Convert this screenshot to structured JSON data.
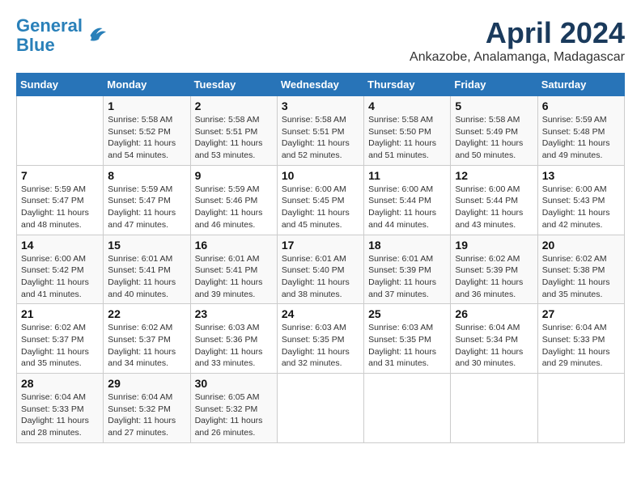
{
  "header": {
    "logo_line1": "General",
    "logo_line2": "Blue",
    "month": "April 2024",
    "location": "Ankazobe, Analamanga, Madagascar"
  },
  "columns": [
    "Sunday",
    "Monday",
    "Tuesday",
    "Wednesday",
    "Thursday",
    "Friday",
    "Saturday"
  ],
  "weeks": [
    [
      {
        "num": "",
        "info": ""
      },
      {
        "num": "1",
        "info": "Sunrise: 5:58 AM\nSunset: 5:52 PM\nDaylight: 11 hours\nand 54 minutes."
      },
      {
        "num": "2",
        "info": "Sunrise: 5:58 AM\nSunset: 5:51 PM\nDaylight: 11 hours\nand 53 minutes."
      },
      {
        "num": "3",
        "info": "Sunrise: 5:58 AM\nSunset: 5:51 PM\nDaylight: 11 hours\nand 52 minutes."
      },
      {
        "num": "4",
        "info": "Sunrise: 5:58 AM\nSunset: 5:50 PM\nDaylight: 11 hours\nand 51 minutes."
      },
      {
        "num": "5",
        "info": "Sunrise: 5:58 AM\nSunset: 5:49 PM\nDaylight: 11 hours\nand 50 minutes."
      },
      {
        "num": "6",
        "info": "Sunrise: 5:59 AM\nSunset: 5:48 PM\nDaylight: 11 hours\nand 49 minutes."
      }
    ],
    [
      {
        "num": "7",
        "info": "Sunrise: 5:59 AM\nSunset: 5:47 PM\nDaylight: 11 hours\nand 48 minutes."
      },
      {
        "num": "8",
        "info": "Sunrise: 5:59 AM\nSunset: 5:47 PM\nDaylight: 11 hours\nand 47 minutes."
      },
      {
        "num": "9",
        "info": "Sunrise: 5:59 AM\nSunset: 5:46 PM\nDaylight: 11 hours\nand 46 minutes."
      },
      {
        "num": "10",
        "info": "Sunrise: 6:00 AM\nSunset: 5:45 PM\nDaylight: 11 hours\nand 45 minutes."
      },
      {
        "num": "11",
        "info": "Sunrise: 6:00 AM\nSunset: 5:44 PM\nDaylight: 11 hours\nand 44 minutes."
      },
      {
        "num": "12",
        "info": "Sunrise: 6:00 AM\nSunset: 5:44 PM\nDaylight: 11 hours\nand 43 minutes."
      },
      {
        "num": "13",
        "info": "Sunrise: 6:00 AM\nSunset: 5:43 PM\nDaylight: 11 hours\nand 42 minutes."
      }
    ],
    [
      {
        "num": "14",
        "info": "Sunrise: 6:00 AM\nSunset: 5:42 PM\nDaylight: 11 hours\nand 41 minutes."
      },
      {
        "num": "15",
        "info": "Sunrise: 6:01 AM\nSunset: 5:41 PM\nDaylight: 11 hours\nand 40 minutes."
      },
      {
        "num": "16",
        "info": "Sunrise: 6:01 AM\nSunset: 5:41 PM\nDaylight: 11 hours\nand 39 minutes."
      },
      {
        "num": "17",
        "info": "Sunrise: 6:01 AM\nSunset: 5:40 PM\nDaylight: 11 hours\nand 38 minutes."
      },
      {
        "num": "18",
        "info": "Sunrise: 6:01 AM\nSunset: 5:39 PM\nDaylight: 11 hours\nand 37 minutes."
      },
      {
        "num": "19",
        "info": "Sunrise: 6:02 AM\nSunset: 5:39 PM\nDaylight: 11 hours\nand 36 minutes."
      },
      {
        "num": "20",
        "info": "Sunrise: 6:02 AM\nSunset: 5:38 PM\nDaylight: 11 hours\nand 35 minutes."
      }
    ],
    [
      {
        "num": "21",
        "info": "Sunrise: 6:02 AM\nSunset: 5:37 PM\nDaylight: 11 hours\nand 35 minutes."
      },
      {
        "num": "22",
        "info": "Sunrise: 6:02 AM\nSunset: 5:37 PM\nDaylight: 11 hours\nand 34 minutes."
      },
      {
        "num": "23",
        "info": "Sunrise: 6:03 AM\nSunset: 5:36 PM\nDaylight: 11 hours\nand 33 minutes."
      },
      {
        "num": "24",
        "info": "Sunrise: 6:03 AM\nSunset: 5:35 PM\nDaylight: 11 hours\nand 32 minutes."
      },
      {
        "num": "25",
        "info": "Sunrise: 6:03 AM\nSunset: 5:35 PM\nDaylight: 11 hours\nand 31 minutes."
      },
      {
        "num": "26",
        "info": "Sunrise: 6:04 AM\nSunset: 5:34 PM\nDaylight: 11 hours\nand 30 minutes."
      },
      {
        "num": "27",
        "info": "Sunrise: 6:04 AM\nSunset: 5:33 PM\nDaylight: 11 hours\nand 29 minutes."
      }
    ],
    [
      {
        "num": "28",
        "info": "Sunrise: 6:04 AM\nSunset: 5:33 PM\nDaylight: 11 hours\nand 28 minutes."
      },
      {
        "num": "29",
        "info": "Sunrise: 6:04 AM\nSunset: 5:32 PM\nDaylight: 11 hours\nand 27 minutes."
      },
      {
        "num": "30",
        "info": "Sunrise: 6:05 AM\nSunset: 5:32 PM\nDaylight: 11 hours\nand 26 minutes."
      },
      {
        "num": "",
        "info": ""
      },
      {
        "num": "",
        "info": ""
      },
      {
        "num": "",
        "info": ""
      },
      {
        "num": "",
        "info": ""
      }
    ]
  ]
}
